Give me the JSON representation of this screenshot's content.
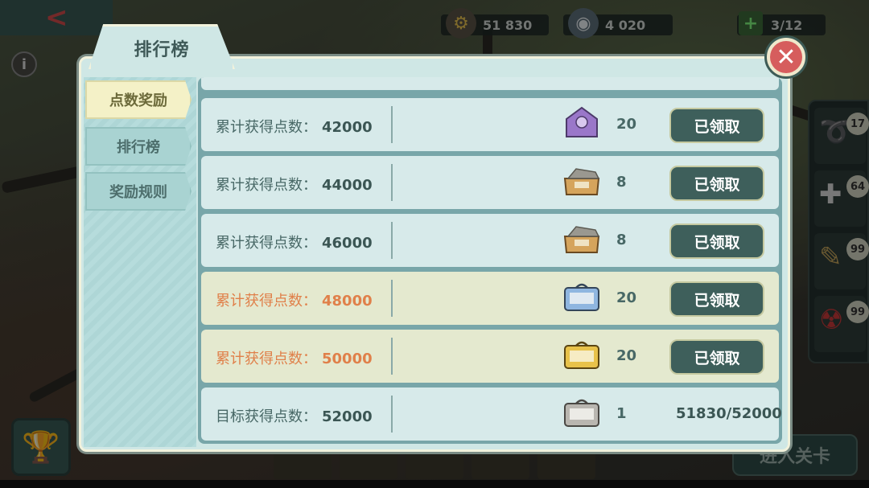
{
  "topbar": {
    "back_label": "<",
    "gears": "51 830",
    "caps": "4 020",
    "energy": "3/12"
  },
  "modal": {
    "title": "排行榜",
    "close_label": "✕",
    "tabs": [
      {
        "label": "点数奖励",
        "active": true
      },
      {
        "label": "排行榜",
        "active": false
      },
      {
        "label": "奖励规则",
        "active": false
      }
    ],
    "rows": [
      {
        "label": "累计获得点数：",
        "points": "42000",
        "qty": "20",
        "action": "已领取",
        "chest": "purple",
        "highlight": false
      },
      {
        "label": "累计获得点数：",
        "points": "44000",
        "qty": "8",
        "action": "已领取",
        "chest": "wood",
        "highlight": false
      },
      {
        "label": "累计获得点数：",
        "points": "46000",
        "qty": "8",
        "action": "已领取",
        "chest": "wood",
        "highlight": false
      },
      {
        "label": "累计获得点数：",
        "points": "48000",
        "qty": "20",
        "action": "已领取",
        "chest": "blue",
        "highlight": true
      },
      {
        "label": "累计获得点数：",
        "points": "50000",
        "qty": "20",
        "action": "已领取",
        "chest": "gold",
        "highlight": true
      },
      {
        "label": "目标获得点数：",
        "points": "52000",
        "qty": "1",
        "progress": "51830/52000",
        "chest": "silver",
        "highlight": false
      }
    ]
  },
  "inventory": [
    {
      "icon": "rope-icon",
      "count": "17"
    },
    {
      "icon": "medkit-icon",
      "count": "64"
    },
    {
      "icon": "stimpak-icon",
      "count": "99"
    },
    {
      "icon": "radaway-icon",
      "count": "99"
    }
  ],
  "enter_label": "进入关卡",
  "colors": {
    "accent": "#3e5f5b",
    "highlight_text": "#e0804a",
    "close_red": "#d65d5d"
  }
}
